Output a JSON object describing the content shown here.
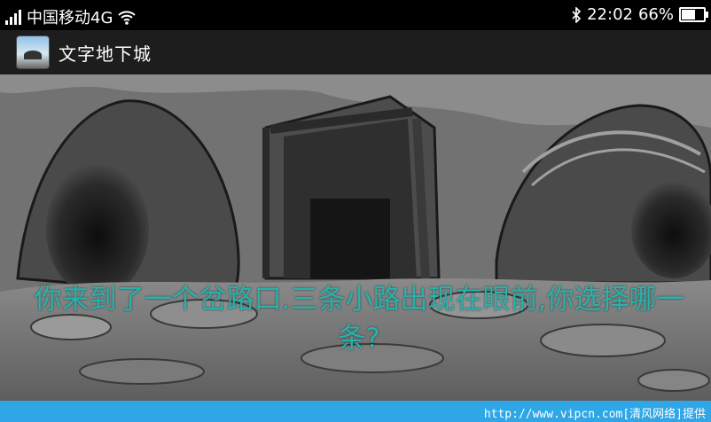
{
  "status_bar": {
    "carrier": "中国移动4G",
    "time": "22:02",
    "battery_text": "66%",
    "battery_level": 0.66,
    "icons": [
      "signal-icon",
      "wifi-icon",
      "bluetooth-icon",
      "battery-icon"
    ]
  },
  "app": {
    "title": "文字地下城"
  },
  "scene": {
    "message": "你来到了一个岔路口.三条小路出现在眼前,你选择哪一条?",
    "message_color": "#29b2ac"
  },
  "footer": {
    "watermark": "http://www.vipcn.com[清风网络]提供",
    "color": "#2fa6e6"
  }
}
